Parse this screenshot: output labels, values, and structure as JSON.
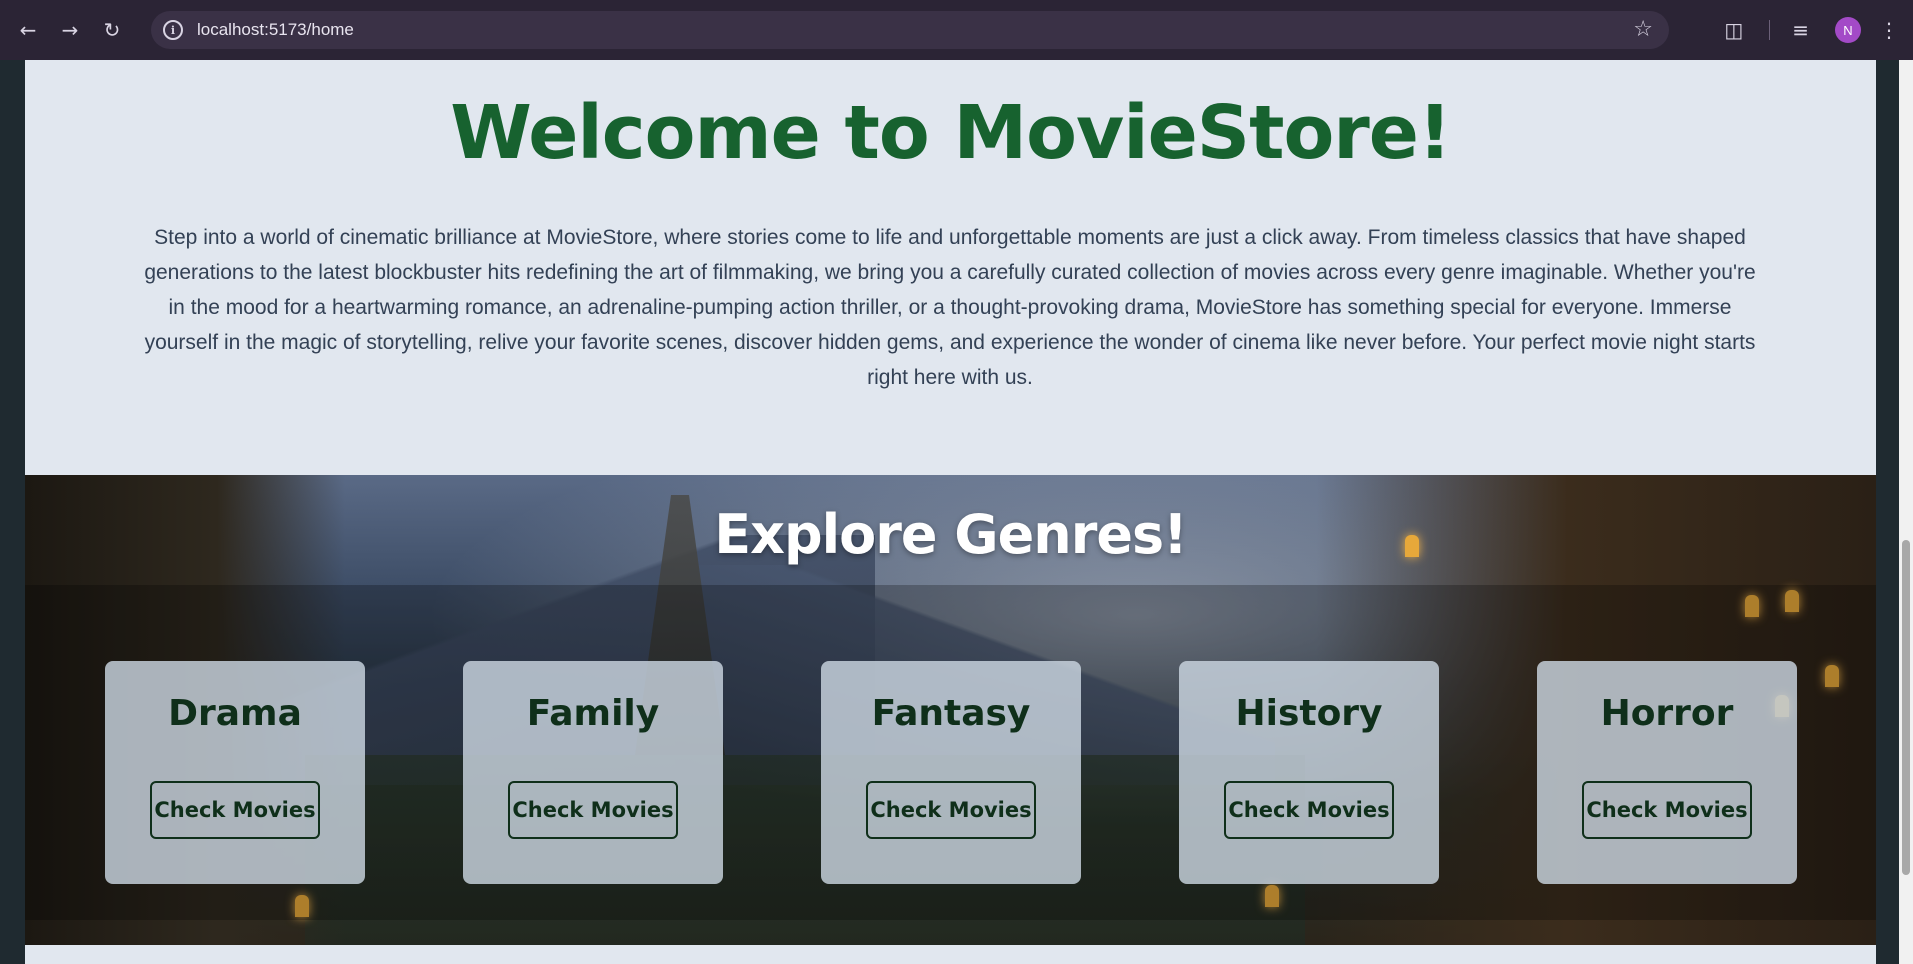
{
  "browser": {
    "url": "localhost:5173/home",
    "avatar_initial": "N"
  },
  "welcome": {
    "title": "Welcome to MovieStore!",
    "description": "Step into a world of cinematic brilliance at MovieStore, where stories come to life and unforgettable moments are just a click away. From timeless classics that have shaped generations to the latest blockbuster hits redefining the art of filmmaking, we bring you a carefully curated collection of movies across every genre imaginable. Whether you're in the mood for a heartwarming romance, an adrenaline-pumping action thriller, or a thought-provoking drama, MovieStore has something special for everyone. Immerse yourself in the magic of storytelling, relive your favorite scenes, discover hidden gems, and experience the wonder of cinema like never before. Your perfect movie night starts right here with us."
  },
  "genres": {
    "title": "Explore Genres!",
    "items": [
      {
        "name": "Drama",
        "button": "Check Movies"
      },
      {
        "name": "Family",
        "button": "Check Movies"
      },
      {
        "name": "Fantasy",
        "button": "Check Movies"
      },
      {
        "name": "History",
        "button": "Check Movies"
      },
      {
        "name": "Horror",
        "button": "Check Movies"
      }
    ]
  }
}
